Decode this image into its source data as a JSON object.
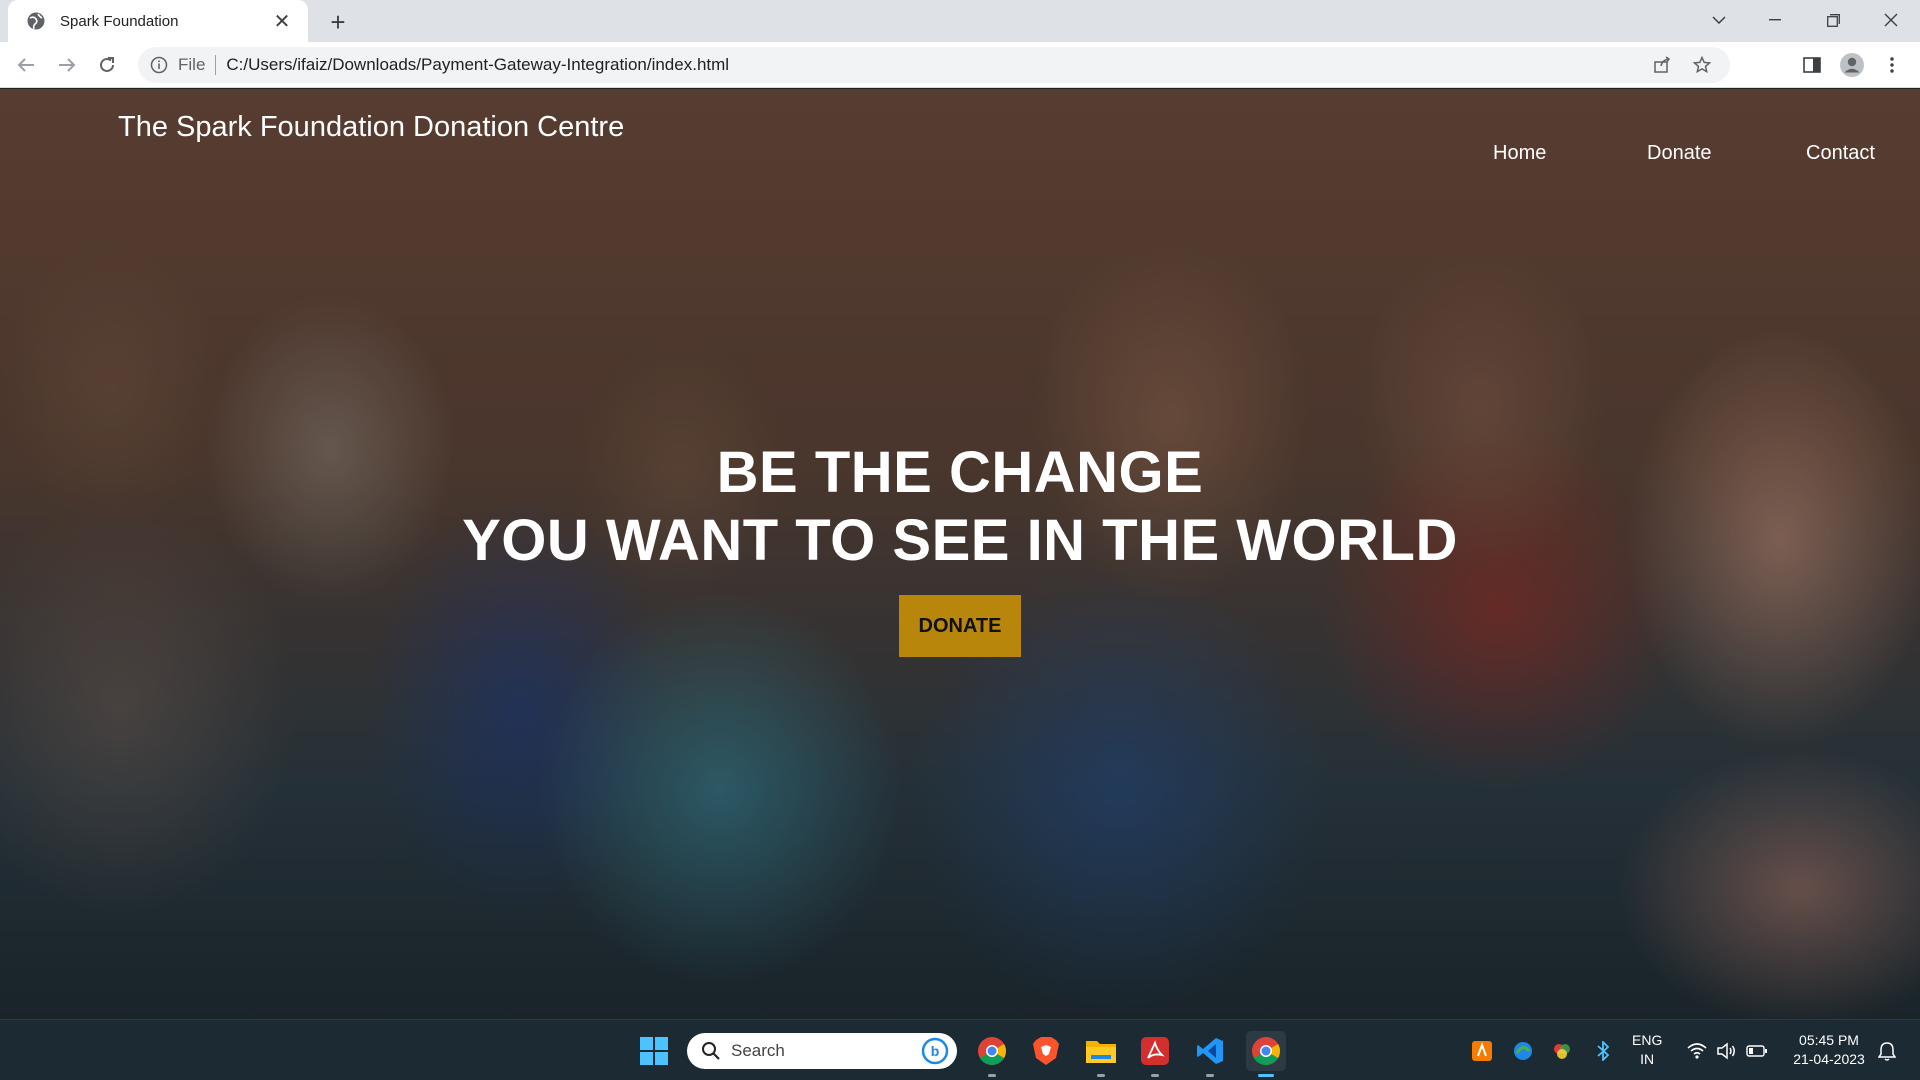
{
  "browser": {
    "tab_title": "Spark Foundation",
    "new_tab_label": "+",
    "omnibox": {
      "scheme_label": "File",
      "url": "C:/Users/ifaiz/Downloads/Payment-Gateway-Integration/index.html"
    }
  },
  "site": {
    "brand": "The Spark Foundation Donation Centre",
    "nav": [
      "Home",
      "Donate",
      "Contact"
    ],
    "hero": {
      "line1": "BE THE CHANGE",
      "line2": "YOU WANT TO SEE IN THE WORLD",
      "cta": "DONATE"
    }
  },
  "taskbar": {
    "search_placeholder": "Search",
    "pinned_apps": [
      "windows-start-icon",
      "chrome-icon",
      "brave-icon",
      "file-explorer-icon",
      "acrobat-icon",
      "vscode-icon",
      "chrome-active-icon"
    ],
    "lang_line1": "ENG",
    "lang_line2": "IN",
    "time": "05:45 PM",
    "date": "21-04-2023"
  },
  "colors": {
    "cta_background": "#b8860b",
    "taskbar": "#1c2a33",
    "tabstrip": "#dee1e6"
  }
}
